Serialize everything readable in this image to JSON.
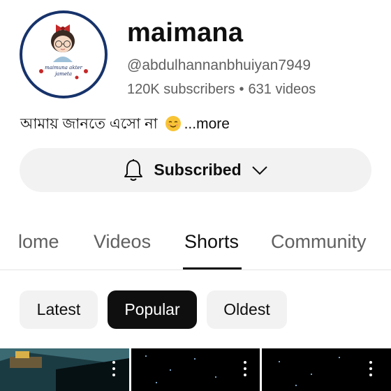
{
  "channel": {
    "name": "maimana",
    "handle": "@abdulhannanbhuiyan7949",
    "subscribers": "120K subscribers",
    "separator": "•",
    "videos": "631 videos",
    "description": "আমায় জানতে এসো না",
    "more_label": "...more",
    "avatar_caption_line1": "maimuna akter",
    "avatar_caption_line2": "jameta"
  },
  "subscribe_button": {
    "label": "Subscribed",
    "icon": "bell-icon",
    "chevron_icon": "chevron-down-icon"
  },
  "tabs": [
    {
      "label": "Home",
      "visible_text": "lome",
      "active": false
    },
    {
      "label": "Videos",
      "active": false
    },
    {
      "label": "Shorts",
      "active": true
    },
    {
      "label": "Community",
      "active": false
    }
  ],
  "filters": [
    {
      "label": "Latest",
      "selected": false
    },
    {
      "label": "Popular",
      "selected": true
    },
    {
      "label": "Oldest",
      "selected": false
    }
  ],
  "colors": {
    "text_primary": "#0f0f0f",
    "text_secondary": "#606060",
    "chip_bg": "#f2f2f2",
    "avatar_ring": "#17336b"
  }
}
